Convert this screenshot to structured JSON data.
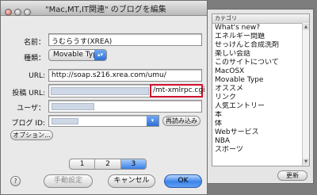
{
  "window": {
    "title": "\"Mac,MT,IT関連\" のブログを編集"
  },
  "form": {
    "name_label": "名前：",
    "name_value": "うむらうす(XREA)",
    "type_label": "種類：",
    "type_value": "Movable Type",
    "url_label": "URL:",
    "url_value": "http://soap.s216.xrea.com/umu/",
    "post_url_label": "投稿 URL:",
    "post_url_suffix": "/mt-xmlrpc.cgi",
    "user_label": "ユーザ：",
    "blog_id_label": "ブログ ID:",
    "reload_button": "再読み込み",
    "options_button": "オプション..."
  },
  "pager": {
    "pages": [
      "1",
      "2",
      "3"
    ],
    "active": "3"
  },
  "footer": {
    "help_glyph": "?",
    "manual_button": "手動設定",
    "cancel_button": "キャンセル",
    "ok_button": "OK"
  },
  "categories": {
    "header": "カテゴリ",
    "items": [
      "What's new?",
      "エネルギー問題",
      "せっけんと合成洗剤",
      "楽しい会話",
      "このサイトについて",
      "MacOSX",
      "Movable Type",
      "オススメ",
      "リンク",
      "人気エントリー",
      "本",
      "体",
      "Webサービス",
      "NBA",
      "スポーツ"
    ],
    "update_button": "更新"
  },
  "colors": {
    "accent": "#3a7fe6",
    "highlight_border": "#d0102d"
  }
}
